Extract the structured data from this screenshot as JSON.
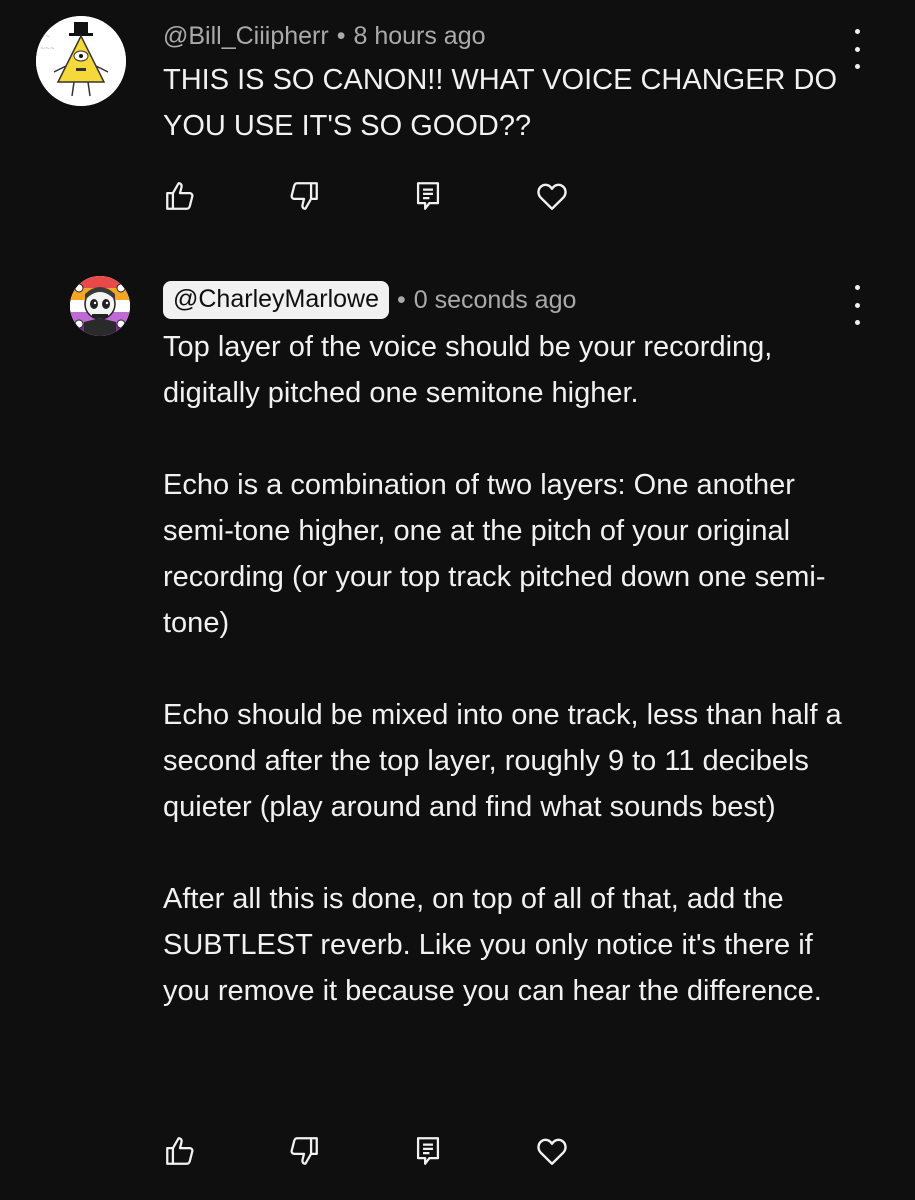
{
  "comments": [
    {
      "author": "@Bill_Ciiipherr",
      "separator": "•",
      "time": "8 hours ago",
      "paragraphs": [
        "THIS IS SO CANON!! WHAT VOICE CHANGER DO YOU USE IT'S SO GOOD??"
      ],
      "avatar_icon": "bill-cipher-drawing-avatar"
    },
    {
      "author": "@CharleyMarlowe",
      "separator": "•",
      "time": "0 seconds ago",
      "paragraphs": [
        "Top layer of the voice should be your recording, digitally pitched one semitone higher.",
        "Echo is a combination of two layers: One another semi-tone higher, one at the pitch of your original recording (or your top track pitched down one semi-tone)",
        "Echo should be mixed into one track, less than half a second after the top layer, roughly 9 to 11 decibels quieter (play around and find what sounds best)",
        "After all this is done, on top of all of that, add the SUBTLEST reverb. Like you only notice it's there if you remove it because you can hear the difference."
      ],
      "avatar_icon": "skull-character-avatar"
    }
  ],
  "action_icons": [
    "thumbs-up-icon",
    "thumbs-down-icon",
    "reply-icon",
    "heart-icon"
  ],
  "colors": {
    "background": "#0f0f0f",
    "text": "#f1f1f1",
    "meta": "#aaaaaa"
  }
}
